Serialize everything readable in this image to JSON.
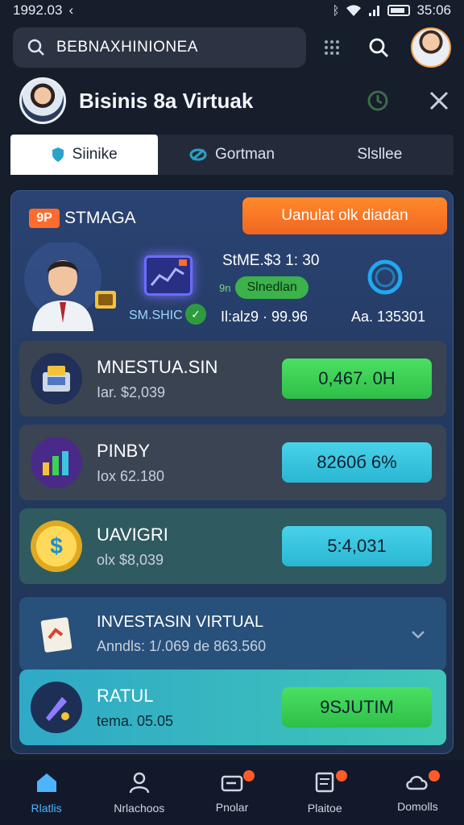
{
  "status": {
    "time": "1992.03",
    "clock": "35:06"
  },
  "search": {
    "value": "BEBNAXHINIONEA"
  },
  "header": {
    "title": "Bisinis 8a Virtuak"
  },
  "tabs": [
    {
      "label": "Siinike"
    },
    {
      "label": "Gortman"
    },
    {
      "label": "Slsllee"
    }
  ],
  "panel": {
    "badge": "9P",
    "title": "STMAGA",
    "cta": "Uanulat olk diadan",
    "sub_label": "SM.SHIC",
    "stat1": "StME.$3 1: 30",
    "pill_prefix": "9n",
    "pill": "Slnedlan",
    "stat2": "Il:alz9 · 99.96",
    "stat3": "Aa. 135301"
  },
  "cards": [
    {
      "name": "MNESTUA.SIN",
      "sub": "Iar. $2,039",
      "value": "0,467. 0H"
    },
    {
      "name": "PINBY",
      "sub": "Iox 62.180",
      "value": "8260б 6%"
    },
    {
      "name": "UAVIGRI",
      "sub": "olx $8,039",
      "value": "5:4,031"
    },
    {
      "name": "INVESTASIN VIRTUAL",
      "sub": "Anndls: 1/.069  de 863.560"
    },
    {
      "name": "RATUL",
      "sub": "tema. 05.05",
      "value": "9SJUTIM"
    }
  ],
  "nav": [
    {
      "label": "Rlatlis"
    },
    {
      "label": "Nrlachoos"
    },
    {
      "label": "Pnolar"
    },
    {
      "label": "Plaitoe"
    },
    {
      "label": "Domolls"
    }
  ],
  "colors": {
    "accent": "#ff6b2c",
    "active_nav": "#4db4ff",
    "green": "#3bd255",
    "cyan": "#3cc6e0"
  }
}
